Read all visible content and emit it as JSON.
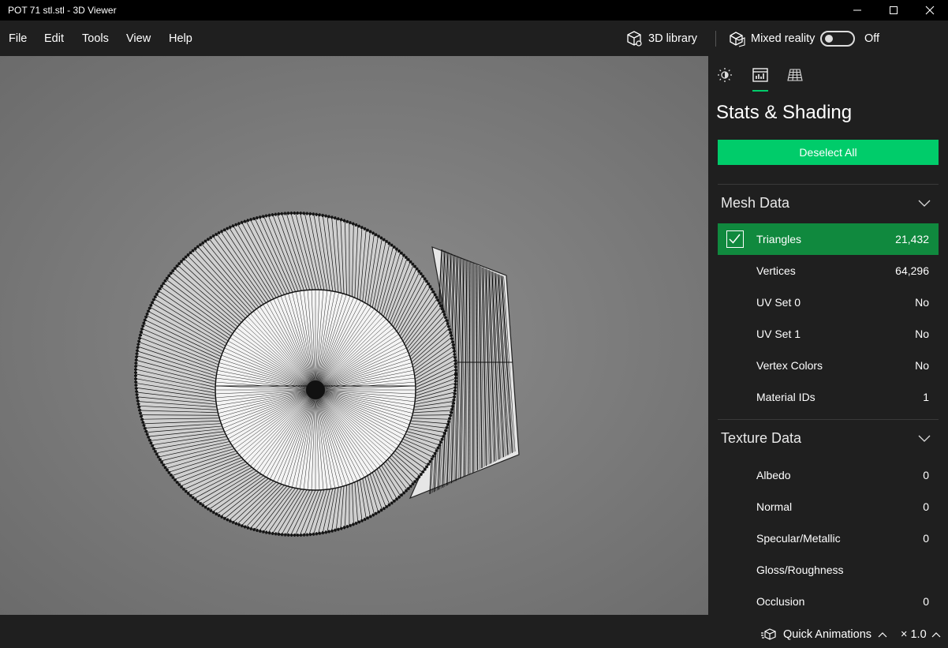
{
  "window": {
    "title": "POT 71 stl.stl - 3D Viewer",
    "controls": [
      "minimize-icon",
      "maximize-icon",
      "close-icon"
    ]
  },
  "menu": {
    "items": [
      "File",
      "Edit",
      "Tools",
      "View",
      "Help"
    ],
    "library_label": "3D library",
    "mixed_reality_label": "Mixed reality",
    "mixed_reality_state": "Off"
  },
  "panel": {
    "tabs": [
      {
        "name": "lighting",
        "icon": "sun-icon",
        "active": false
      },
      {
        "name": "stats",
        "icon": "stats-chart-icon",
        "active": true
      },
      {
        "name": "grid",
        "icon": "grid-icon",
        "active": false
      }
    ],
    "title": "Stats & Shading",
    "deselect_label": "Deselect All",
    "mesh": {
      "heading": "Mesh Data",
      "rows": [
        {
          "label": "Triangles",
          "value": "21,432",
          "checked": true
        },
        {
          "label": "Vertices",
          "value": "64,296"
        },
        {
          "label": "UV Set 0",
          "value": "No"
        },
        {
          "label": "UV Set 1",
          "value": "No"
        },
        {
          "label": "Vertex Colors",
          "value": "No"
        },
        {
          "label": "Material IDs",
          "value": "1"
        }
      ]
    },
    "texture": {
      "heading": "Texture Data",
      "rows": [
        {
          "label": "Albedo",
          "value": "0"
        },
        {
          "label": "Normal",
          "value": "0"
        },
        {
          "label": "Specular/Metallic",
          "value": "0"
        },
        {
          "label": "Gloss/Roughness",
          "value": ""
        },
        {
          "label": "Occlusion",
          "value": "0"
        }
      ]
    }
  },
  "status": {
    "animations_label": "Quick Animations",
    "speed": "× 1.0"
  },
  "colors": {
    "accent": "#00cc6a",
    "selected_row": "#10893e",
    "chrome": "#1f1f1f"
  }
}
